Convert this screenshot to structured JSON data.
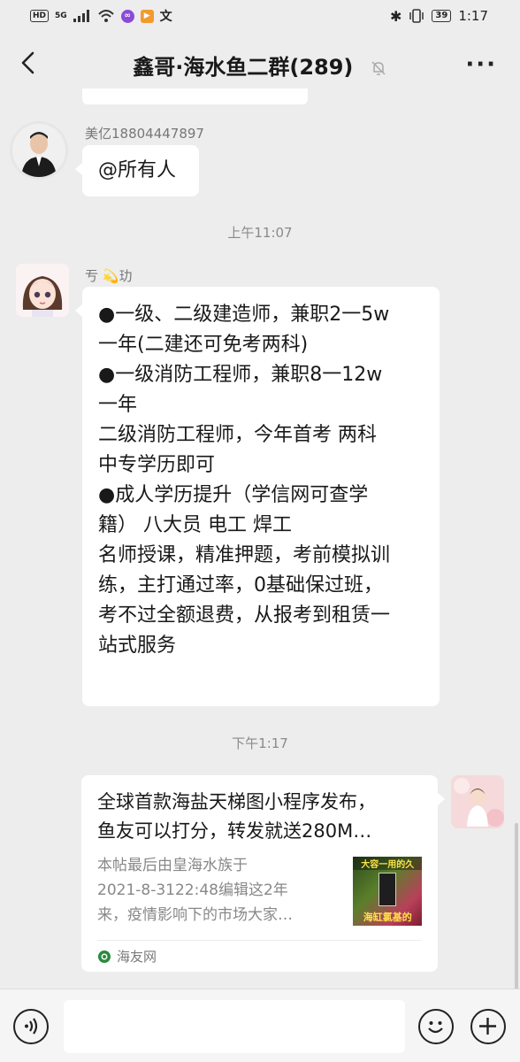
{
  "status_bar": {
    "hd": "HD",
    "network": "5G",
    "time": "1:17",
    "battery": "39"
  },
  "header": {
    "title": "鑫哥·海水鱼二群(289)",
    "back_icon": "chevron-left-icon",
    "mute_icon": "bell-off-icon",
    "more_icon": "more-dots-icon",
    "more_label": "···"
  },
  "messages": [
    {
      "sender": "美亿18804447897",
      "text": "@所有人"
    },
    {
      "timestamp": "上午11:07"
    },
    {
      "sender": "亐 💫玏",
      "text": "●一级、二级建造师，兼职2一5w\n一年(二建还可免考两科)\n●一级消防工程师，兼职8一12w\n一年\n二级消防工程师，今年首考 两科\n中专学历即可\n●成人学历提升（学信网可查学\n籍） 八大员  电工 焊工\n名师授课，精准押题，考前模拟训\n练，主打通过率，0基础保过班，\n考不过全额退费，从报考到租赁一\n站式服务"
    },
    {
      "timestamp": "下午1:17"
    },
    {
      "card": {
        "title": "全球首款海盐天梯图小程序发布，\n鱼友可以打分，转发就送280M…",
        "desc": "本帖最后由皇海水族于\n2021-8-3122:48编辑这2年\n来，疫情影响下的市场大家…",
        "thumb_top": "大容一用的久",
        "thumb_bottom": "海缸氯基的",
        "source": "海友网"
      }
    }
  ],
  "input_bar": {
    "voice_icon": "voice-icon",
    "emoji_icon": "emoji-icon",
    "plus_icon": "plus-icon"
  }
}
